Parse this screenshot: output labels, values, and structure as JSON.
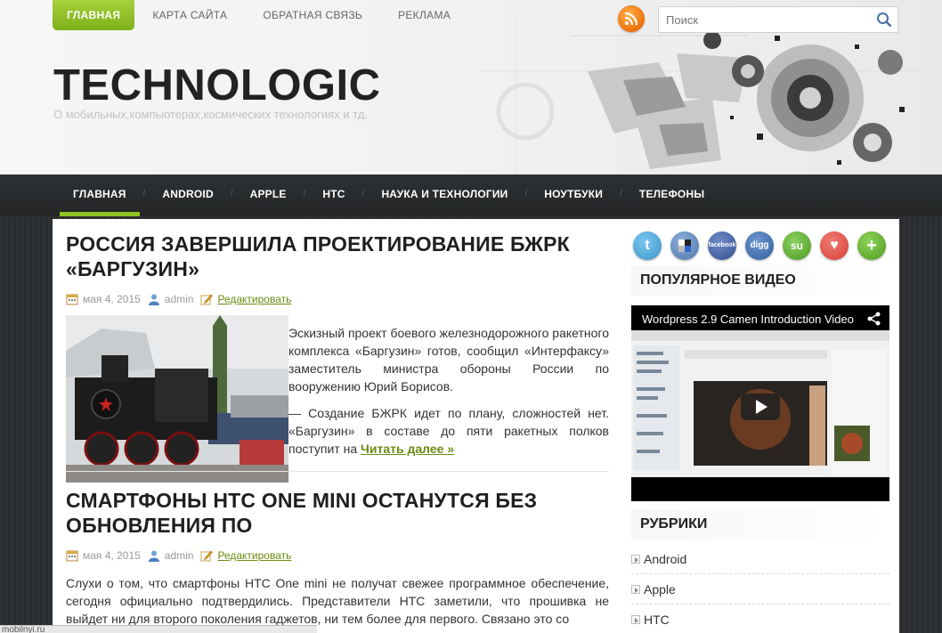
{
  "top_nav": {
    "items": [
      {
        "label": "ГЛАВНАЯ",
        "active": true
      },
      {
        "label": "КАРТА САЙТА",
        "active": false
      },
      {
        "label": "ОБРАТНАЯ СВЯЗЬ",
        "active": false
      },
      {
        "label": "РЕКЛАМА",
        "active": false
      }
    ]
  },
  "search": {
    "placeholder": "Поиск"
  },
  "site": {
    "title": "TECHNOLOGIC",
    "description": "О мобильных,компьютерах,космических технологиях и тд."
  },
  "main_nav": {
    "items": [
      {
        "label": "ГЛАВНАЯ",
        "active": true
      },
      {
        "label": "ANDROID"
      },
      {
        "label": "APPLE"
      },
      {
        "label": "HTC"
      },
      {
        "label": "НАУКА И ТЕХНОЛОГИИ"
      },
      {
        "label": "НОУТБУКИ"
      },
      {
        "label": "ТЕЛЕФОНЫ"
      }
    ]
  },
  "posts": [
    {
      "title": "РОССИЯ ЗАВЕРШИЛА ПРОЕКТИРОВАНИЕ БЖРК «БАРГУЗИН»",
      "date": "мая 4, 2015",
      "author": "admin",
      "edit": "Редактировать",
      "p1": "Эскизный проект боевого железнодорожного ракетного комплекса «Баргузин» готов, сообщил «Интерфаксу» заместитель министра обороны России по вооружению Юрий Борисов.",
      "p2": "— Создание БЖРК идет по плану, сложностей нет. «Баргузин» в составе до пяти ракетных полков поступит на ",
      "read_more": "Читать далее »"
    },
    {
      "title": "СМАРТФОНЫ HTC ONE MINI ОСТАНУТСЯ БЕЗ ОБНОВЛЕНИЯ ПО",
      "date": "мая 4, 2015",
      "author": "admin",
      "edit": "Редактировать",
      "p1": "Слухи о том, что смартфоны HTC One mini не получат свежее программное обеспечение, сегодня официально подтвердились. Представители HTC заметили, что прошивка не выйдет ни для второго  поколения гаджетов, ни тем более для первого. Связано это со"
    }
  ],
  "sidebar": {
    "social_icons": [
      {
        "name": "twitter-icon",
        "color": "#4aa7d8",
        "glyph": "t"
      },
      {
        "name": "delicious-icon",
        "color": "#5a7fb0",
        "glyph": ""
      },
      {
        "name": "facebook-icon",
        "color": "#3b5a99",
        "glyph": "facebook"
      },
      {
        "name": "digg-icon",
        "color": "#3d6aa6",
        "glyph": "digg"
      },
      {
        "name": "stumbleupon-icon",
        "color": "#5aa32c",
        "glyph": "su"
      },
      {
        "name": "favorite-icon",
        "color": "#e2504a",
        "glyph": "♥"
      },
      {
        "name": "add-icon",
        "color": "#5fb027",
        "glyph": "+"
      }
    ],
    "popular_video_title": "ПОПУЛЯРНОЕ ВИДЕО",
    "video_caption": "Wordpress 2.9 Camen Introduction Video",
    "categories_title": "РУБРИКИ",
    "categories": [
      "Android",
      "Apple",
      "HTC"
    ]
  },
  "statusbar": {
    "text": "mobilnyi.ru"
  }
}
